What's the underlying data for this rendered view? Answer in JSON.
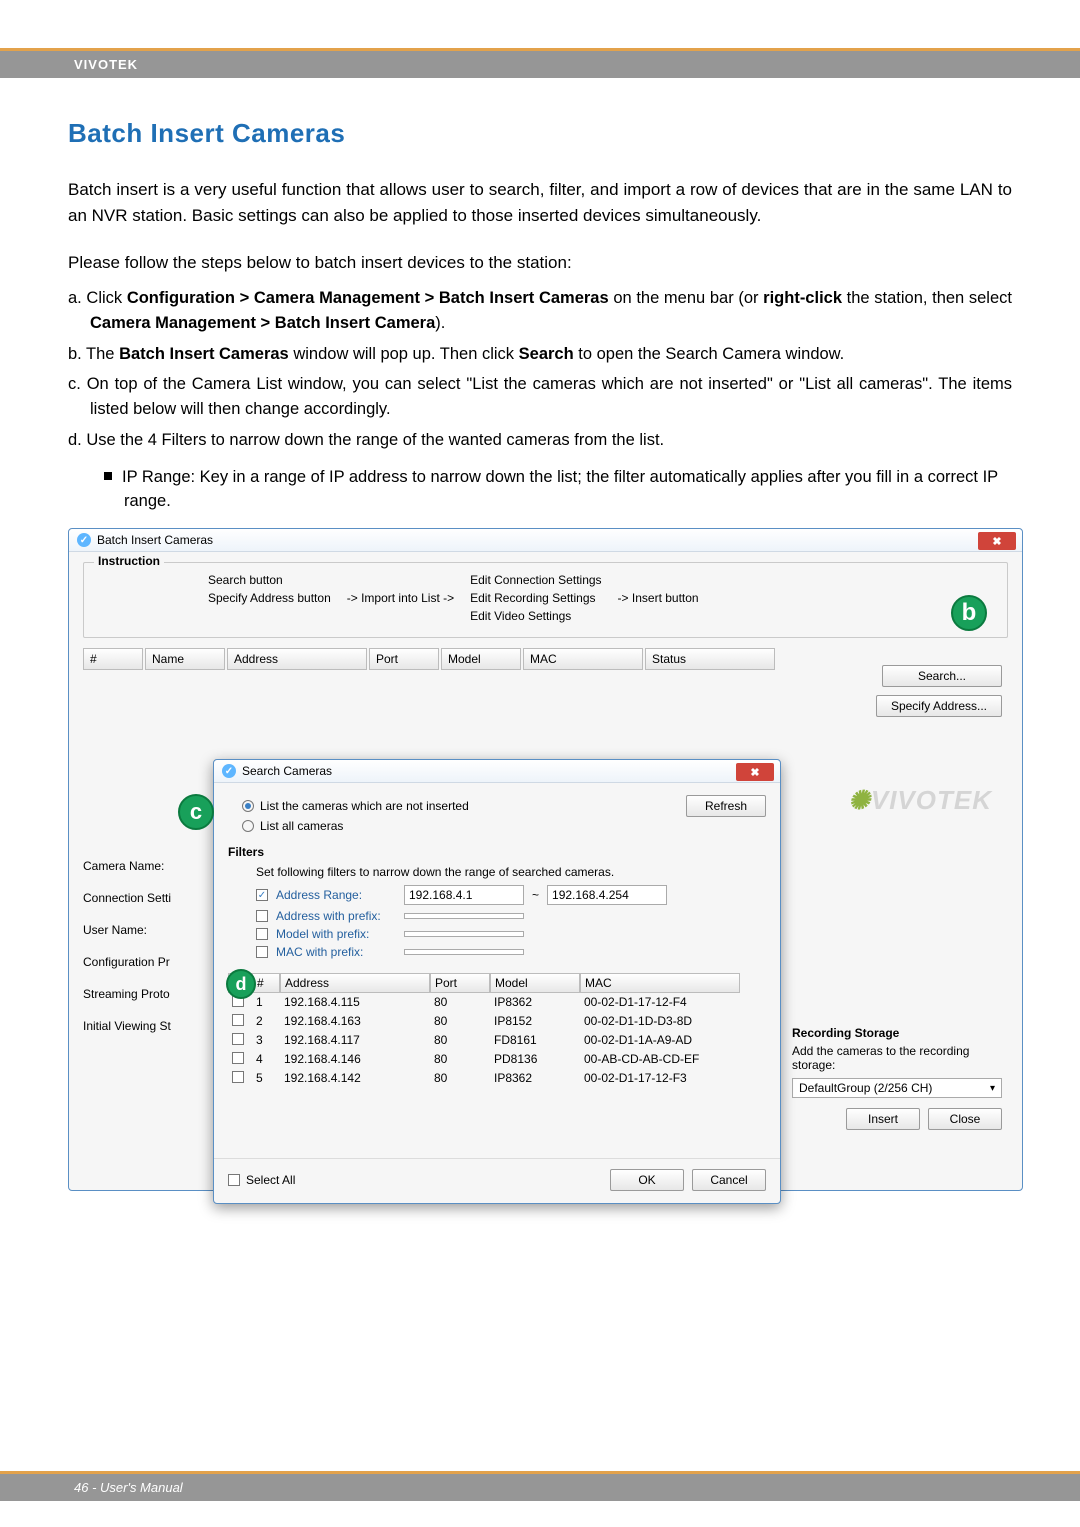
{
  "header": {
    "brand": "VIVOTEK"
  },
  "section_title": "Batch Insert Cameras",
  "paragraphs": {
    "intro": "Batch insert is a very useful function that allows user to search, filter, and import a row of devices that are in the same LAN to an NVR station. Basic settings can also be applied to those inserted devices simultaneously.",
    "follow": "Please follow the steps below to batch insert devices to the station:"
  },
  "steps": {
    "a_prefix": "a. Click ",
    "a_bold1": "Configuration > Camera Management > Batch Insert Cameras",
    "a_mid": " on the menu bar (or ",
    "a_bold2": "right-click",
    "a_mid2": " the station, then select ",
    "a_bold3": "Camera Management > Batch Insert Camera",
    "a_end": ").",
    "b_prefix": "b. The ",
    "b_bold1": "Batch Insert Cameras",
    "b_mid": " window will pop up. Then click ",
    "b_bold2": "Search",
    "b_end": " to open the Search Camera window.",
    "c": "c. On top of the Camera List window, you can select \"List the cameras which are not inserted\" or \"List all cameras\". The items listed below will then change accordingly.",
    "d": "d. Use the 4 Filters to narrow down the range of the wanted cameras from the list.",
    "d1": "IP Range: Key in a range of IP address to narrow down the list; the filter automatically applies after you fill in a correct IP range."
  },
  "win": {
    "title": "Batch Insert Cameras",
    "instruction_label": "Instruction",
    "col1": [
      "Search button",
      "Specify Address button"
    ],
    "arrow1": "->  Import into List  ->",
    "col2": [
      "Edit Connection Settings",
      "Edit Recording Settings",
      "Edit Video Settings"
    ],
    "arrow2": "->  Insert button",
    "badge_b": "b",
    "columns": [
      "#",
      "Name",
      "Address",
      "Port",
      "Model",
      "MAC",
      "Status"
    ],
    "buttons": {
      "search": "Search...",
      "specify": "Specify Address..."
    },
    "left_labels": [
      "Camera Name:",
      "Connection Setti",
      "User Name:",
      "Configuration Pr",
      "Streaming Proto",
      "Initial Viewing St"
    ],
    "logo": "VIVOTEK",
    "recording": {
      "title": "Recording Storage",
      "hint": "Add the cameras to the recording storage:",
      "select": "DefaultGroup (2/256 CH)",
      "insert": "Insert",
      "close": "Close"
    }
  },
  "dlg": {
    "title": "Search Cameras",
    "badge_c": "c",
    "radio1": "List the cameras which are not inserted",
    "radio2": "List all cameras",
    "refresh": "Refresh",
    "filters_label": "Filters",
    "hint": "Set following filters to narrow down the range of searched cameras.",
    "badge_d": "d",
    "filters": {
      "addr_range_lbl": "Address Range:",
      "addr_from": "192.168.4.1",
      "tilde": "~",
      "addr_to": "192.168.4.254",
      "addr_prefix_lbl": "Address with prefix:",
      "model_prefix_lbl": "Model with prefix:",
      "mac_prefix_lbl": "MAC with prefix:"
    },
    "columns": [
      "#",
      "Address",
      "Port",
      "Model",
      "MAC"
    ],
    "rows": [
      {
        "n": "1",
        "addr": "192.168.4.115",
        "port": "80",
        "model": "IP8362",
        "mac": "00-02-D1-17-12-F4"
      },
      {
        "n": "2",
        "addr": "192.168.4.163",
        "port": "80",
        "model": "IP8152",
        "mac": "00-02-D1-1D-D3-8D"
      },
      {
        "n": "3",
        "addr": "192.168.4.117",
        "port": "80",
        "model": "FD8161",
        "mac": "00-02-D1-1A-A9-AD"
      },
      {
        "n": "4",
        "addr": "192.168.4.146",
        "port": "80",
        "model": "PD8136",
        "mac": "00-AB-CD-AB-CD-EF"
      },
      {
        "n": "5",
        "addr": "192.168.4.142",
        "port": "80",
        "model": "IP8362",
        "mac": "00-02-D1-17-12-F3"
      }
    ],
    "select_all": "Select All",
    "ok": "OK",
    "cancel": "Cancel"
  },
  "footer": "46 - User's Manual"
}
